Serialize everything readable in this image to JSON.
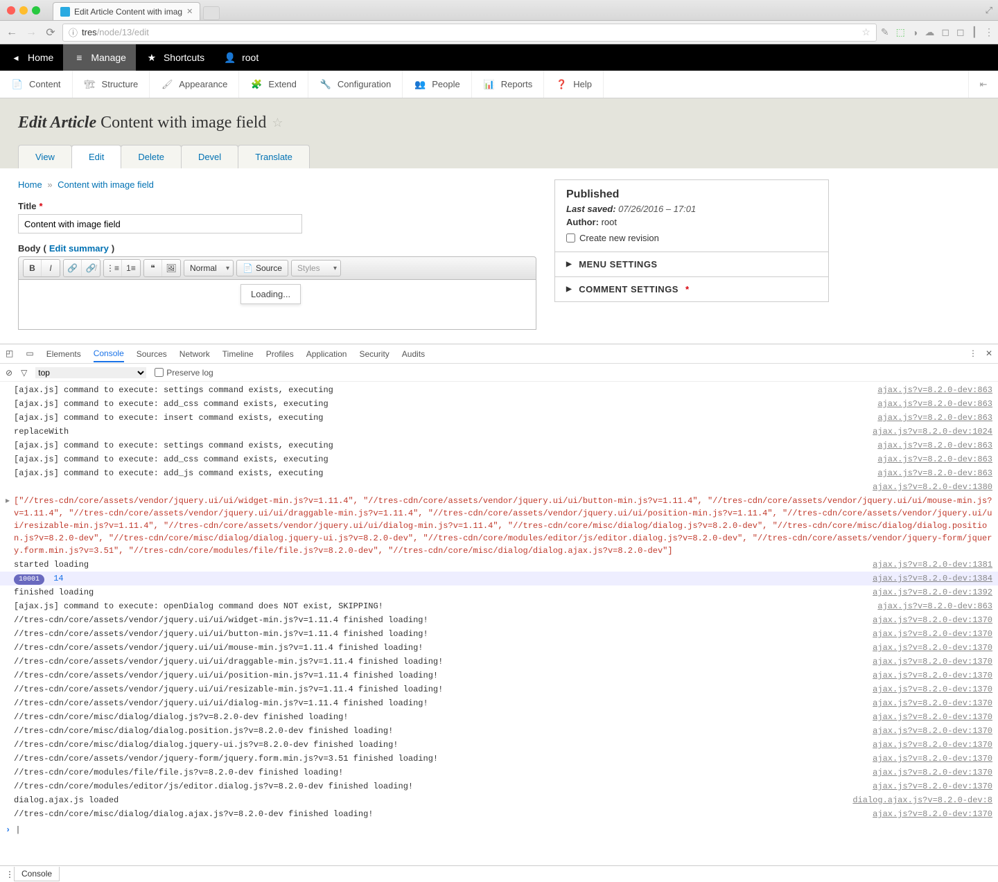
{
  "browser": {
    "tab_title": "Edit Article Content with imag",
    "url_host": "tres",
    "url_path": "/node/13/edit"
  },
  "toolbar": {
    "home": "Home",
    "manage": "Manage",
    "shortcuts": "Shortcuts",
    "user": "root"
  },
  "admin_menu": {
    "content": "Content",
    "structure": "Structure",
    "appearance": "Appearance",
    "extend": "Extend",
    "configuration": "Configuration",
    "people": "People",
    "reports": "Reports",
    "help": "Help"
  },
  "page": {
    "title_prefix": "Edit Article",
    "title_suffix": "Content with image field"
  },
  "tabs": {
    "view": "View",
    "edit": "Edit",
    "delete": "Delete",
    "devel": "Devel",
    "translate": "Translate"
  },
  "breadcrumb": {
    "home": "Home",
    "current": "Content with image field"
  },
  "form": {
    "title_label": "Title",
    "title_value": "Content with image field",
    "body_label": "Body",
    "edit_summary": "Edit summary",
    "format_normal": "Normal",
    "source": "Source",
    "styles": "Styles",
    "loading": "Loading..."
  },
  "sidebar": {
    "published": "Published",
    "last_saved_label": "Last saved:",
    "last_saved_value": "07/26/2016 – 17:01",
    "author_label": "Author:",
    "author_value": "root",
    "create_revision": "Create new revision",
    "menu_settings": "MENU SETTINGS",
    "comment_settings": "COMMENT SETTINGS"
  },
  "devtools": {
    "tabs": [
      "Elements",
      "Console",
      "Sources",
      "Network",
      "Timeline",
      "Profiles",
      "Application",
      "Security",
      "Audits"
    ],
    "active_tab": "Console",
    "filter_top": "top",
    "preserve_log": "Preserve log",
    "badge_count": "10001",
    "badge_value": "14",
    "drawer_tab": "Console",
    "logs": [
      {
        "t": "n",
        "m": "[ajax.js] command to execute: settings command exists, executing",
        "s": "ajax.js?v=8.2.0-dev:863"
      },
      {
        "t": "n",
        "m": "[ajax.js] command to execute: add_css command exists, executing",
        "s": "ajax.js?v=8.2.0-dev:863"
      },
      {
        "t": "n",
        "m": "[ajax.js] command to execute: insert command exists, executing",
        "s": "ajax.js?v=8.2.0-dev:863"
      },
      {
        "t": "n",
        "m": "replaceWith",
        "s": "ajax.js?v=8.2.0-dev:1024"
      },
      {
        "t": "n",
        "m": "[ajax.js] command to execute: settings command exists, executing",
        "s": "ajax.js?v=8.2.0-dev:863"
      },
      {
        "t": "n",
        "m": "[ajax.js] command to execute: add_css command exists, executing",
        "s": "ajax.js?v=8.2.0-dev:863"
      },
      {
        "t": "n",
        "m": "[ajax.js] command to execute: add_js command exists, executing",
        "s": "ajax.js?v=8.2.0-dev:863"
      },
      {
        "t": "n",
        "m": "",
        "s": "ajax.js?v=8.2.0-dev:1380"
      },
      {
        "t": "e",
        "m": "[\"//tres-cdn/core/assets/vendor/jquery.ui/ui/widget-min.js?v=1.11.4\", \"//tres-cdn/core/assets/vendor/jquery.ui/ui/button-min.js?v=1.11.4\", \"//tres-cdn/core/assets/vendor/jquery.ui/ui/mouse-min.js?v=1.11.4\", \"//tres-cdn/core/assets/vendor/jquery.ui/ui/draggable-min.js?v=1.11.4\", \"//tres-cdn/core/assets/vendor/jquery.ui/ui/position-min.js?v=1.11.4\", \"//tres-cdn/core/assets/vendor/jquery.ui/ui/resizable-min.js?v=1.11.4\", \"//tres-cdn/core/assets/vendor/jquery.ui/ui/dialog-min.js?v=1.11.4\", \"//tres-cdn/core/misc/dialog/dialog.js?v=8.2.0-dev\", \"//tres-cdn/core/misc/dialog/dialog.position.js?v=8.2.0-dev\", \"//tres-cdn/core/misc/dialog/dialog.jquery-ui.js?v=8.2.0-dev\", \"//tres-cdn/core/modules/editor/js/editor.dialog.js?v=8.2.0-dev\", \"//tres-cdn/core/assets/vendor/jquery-form/jquery.form.min.js?v=3.51\", \"//tres-cdn/core/modules/file/file.js?v=8.2.0-dev\", \"//tres-cdn/core/misc/dialog/dialog.ajax.js?v=8.2.0-dev\"]",
        "s": ""
      },
      {
        "t": "n",
        "m": "started loading",
        "s": "ajax.js?v=8.2.0-dev:1381"
      },
      {
        "t": "b",
        "m": "14",
        "s": "ajax.js?v=8.2.0-dev:1384"
      },
      {
        "t": "n",
        "m": "finished loading",
        "s": "ajax.js?v=8.2.0-dev:1392"
      },
      {
        "t": "n",
        "m": "[ajax.js] command to execute: openDialog command does NOT exist, SKIPPING!",
        "s": "ajax.js?v=8.2.0-dev:863"
      },
      {
        "t": "n",
        "m": "//tres-cdn/core/assets/vendor/jquery.ui/ui/widget-min.js?v=1.11.4 finished loading!",
        "s": "ajax.js?v=8.2.0-dev:1370"
      },
      {
        "t": "n",
        "m": "//tres-cdn/core/assets/vendor/jquery.ui/ui/button-min.js?v=1.11.4 finished loading!",
        "s": "ajax.js?v=8.2.0-dev:1370"
      },
      {
        "t": "n",
        "m": "//tres-cdn/core/assets/vendor/jquery.ui/ui/mouse-min.js?v=1.11.4 finished loading!",
        "s": "ajax.js?v=8.2.0-dev:1370"
      },
      {
        "t": "n",
        "m": "//tres-cdn/core/assets/vendor/jquery.ui/ui/draggable-min.js?v=1.11.4 finished loading!",
        "s": "ajax.js?v=8.2.0-dev:1370"
      },
      {
        "t": "n",
        "m": "//tres-cdn/core/assets/vendor/jquery.ui/ui/position-min.js?v=1.11.4 finished loading!",
        "s": "ajax.js?v=8.2.0-dev:1370"
      },
      {
        "t": "n",
        "m": "//tres-cdn/core/assets/vendor/jquery.ui/ui/resizable-min.js?v=1.11.4 finished loading!",
        "s": "ajax.js?v=8.2.0-dev:1370"
      },
      {
        "t": "n",
        "m": "//tres-cdn/core/assets/vendor/jquery.ui/ui/dialog-min.js?v=1.11.4 finished loading!",
        "s": "ajax.js?v=8.2.0-dev:1370"
      },
      {
        "t": "n",
        "m": "//tres-cdn/core/misc/dialog/dialog.js?v=8.2.0-dev finished loading!",
        "s": "ajax.js?v=8.2.0-dev:1370"
      },
      {
        "t": "n",
        "m": "//tres-cdn/core/misc/dialog/dialog.position.js?v=8.2.0-dev finished loading!",
        "s": "ajax.js?v=8.2.0-dev:1370"
      },
      {
        "t": "n",
        "m": "//tres-cdn/core/misc/dialog/dialog.jquery-ui.js?v=8.2.0-dev finished loading!",
        "s": "ajax.js?v=8.2.0-dev:1370"
      },
      {
        "t": "n",
        "m": "//tres-cdn/core/assets/vendor/jquery-form/jquery.form.min.js?v=3.51 finished loading!",
        "s": "ajax.js?v=8.2.0-dev:1370"
      },
      {
        "t": "n",
        "m": "//tres-cdn/core/modules/file/file.js?v=8.2.0-dev finished loading!",
        "s": "ajax.js?v=8.2.0-dev:1370"
      },
      {
        "t": "n",
        "m": "//tres-cdn/core/modules/editor/js/editor.dialog.js?v=8.2.0-dev finished loading!",
        "s": "ajax.js?v=8.2.0-dev:1370"
      },
      {
        "t": "n",
        "m": "dialog.ajax.js loaded",
        "s": "dialog.ajax.js?v=8.2.0-dev:8"
      },
      {
        "t": "n",
        "m": "//tres-cdn/core/misc/dialog/dialog.ajax.js?v=8.2.0-dev finished loading!",
        "s": "ajax.js?v=8.2.0-dev:1370"
      }
    ]
  }
}
